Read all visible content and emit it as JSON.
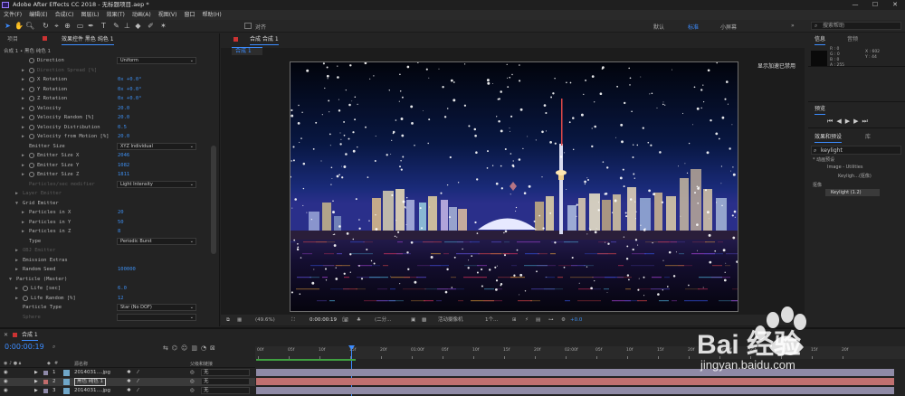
{
  "window": {
    "title": "Adobe After Effects CC 2018 - 无标题项目.aep *",
    "controls": [
      "—",
      "☐",
      "✕"
    ]
  },
  "menu": [
    "文件(F)",
    "编辑(E)",
    "合成(C)",
    "图层(L)",
    "效果(T)",
    "动画(A)",
    "视图(V)",
    "窗口",
    "帮助(H)"
  ],
  "toolbar": {
    "snap_label": "对齐",
    "workspaces": [
      "默认",
      "标准",
      "小屏幕"
    ],
    "active_workspace": "标准",
    "search_placeholder": "搜索帮助",
    "more": "»"
  },
  "left_panel": {
    "tabs": [
      "项目",
      "效果控件 黑色 纯色 1"
    ],
    "breadcrumb": "合成 1 • 黑色 纯色 1",
    "rows": [
      {
        "label": "Direction",
        "dropdown": "Uniform",
        "indent": 2,
        "stopwatch": true
      },
      {
        "label": "Direction Spread [%]",
        "value": "",
        "indent": 2,
        "tri": true,
        "stopwatch": true,
        "dim": true
      },
      {
        "label": "X Rotation",
        "value": "0x +0.0°",
        "indent": 2,
        "tri": true,
        "stopwatch": true
      },
      {
        "label": "Y Rotation",
        "value": "0x +0.0°",
        "indent": 2,
        "tri": true,
        "stopwatch": true
      },
      {
        "label": "Z Rotation",
        "value": "0x +0.0°",
        "indent": 2,
        "tri": true,
        "stopwatch": true
      },
      {
        "label": "Velocity",
        "value": "20.0",
        "indent": 2,
        "tri": true,
        "stopwatch": true
      },
      {
        "label": "Velocity Random [%]",
        "value": "20.0",
        "indent": 2,
        "tri": true,
        "stopwatch": true
      },
      {
        "label": "Velocity Distribution",
        "value": "0.5",
        "indent": 2,
        "tri": true,
        "stopwatch": true
      },
      {
        "label": "Velocity from Motion [%]",
        "value": "20.0",
        "indent": 2,
        "tri": true,
        "stopwatch": true
      },
      {
        "label": "Emitter Size",
        "dropdown": "XYZ Individual",
        "indent": 2,
        "stopwatch": false
      },
      {
        "label": "Emitter Size X",
        "value": "2046",
        "indent": 2,
        "tri": true,
        "stopwatch": true
      },
      {
        "label": "Emitter Size Y",
        "value": "1082",
        "indent": 2,
        "tri": true,
        "stopwatch": true
      },
      {
        "label": "Emitter Size Z",
        "value": "1811",
        "indent": 2,
        "tri": true,
        "stopwatch": true
      },
      {
        "label": "Particles/sec modifier",
        "dropdown": "Light Intensity",
        "indent": 2,
        "dim": true
      },
      {
        "label": "Layer Emitter",
        "indent": 1,
        "tri": true,
        "dim": true
      },
      {
        "label": "Grid Emitter",
        "indent": 1,
        "tri": true,
        "open": true
      },
      {
        "label": "Particles in X",
        "value": "20",
        "indent": 2,
        "tri": true,
        "stopwatch": false
      },
      {
        "label": "Particles in Y",
        "value": "50",
        "indent": 2,
        "tri": true,
        "stopwatch": false
      },
      {
        "label": "Particles in Z",
        "value": "8",
        "indent": 2,
        "tri": true,
        "stopwatch": false
      },
      {
        "label": "Type",
        "dropdown": "Periodic Burst",
        "indent": 2
      },
      {
        "label": "OBJ Emitter",
        "indent": 1,
        "tri": true,
        "dim": true
      },
      {
        "label": "Emission Extras",
        "indent": 1,
        "tri": true
      },
      {
        "label": "Random Seed",
        "value": "100000",
        "indent": 1,
        "tri": true
      },
      {
        "label": "Particle (Master)",
        "indent": 0,
        "tri": true,
        "open": true
      },
      {
        "label": "Life [sec]",
        "value": "6.0",
        "indent": 1,
        "tri": true,
        "stopwatch": true
      },
      {
        "label": "Life Random [%]",
        "value": "12",
        "indent": 1,
        "tri": true,
        "stopwatch": true
      },
      {
        "label": "Particle Type",
        "dropdown": "Star (No DOF)",
        "indent": 1
      },
      {
        "label": "Sphere",
        "dropdown": "",
        "indent": 1,
        "dim": true
      }
    ]
  },
  "viewer": {
    "tab_label": "合成 合成 1",
    "comp_tab": "合成 1",
    "accel_msg": "显示加速已禁用",
    "zoom": "(49.6%)",
    "timecode": "0:00:00:19",
    "resolution": "(二分...",
    "camera": "活动摄像机",
    "views": "1个...",
    "exposure": "+0.0"
  },
  "right_panel": {
    "info_tabs": [
      "信息",
      "音频"
    ],
    "info": {
      "r": "R : 0",
      "g": "G : 0",
      "b": "B : 0",
      "a": "A : 255",
      "x": "X : 602",
      "y": "Y : 44"
    },
    "preview_tab": "预览",
    "effects_tabs": [
      "效果和预设",
      "库"
    ],
    "effects_search": "keylight",
    "tree": [
      "* 动画预设",
      "Image - Utilities",
      "Keyligh...(抠像)",
      "抠像",
      "Keylight (1.2)"
    ]
  },
  "timeline": {
    "tab_label": "合成 1",
    "timecode": "0:00:00:19",
    "col_header": {
      "name": "源名称",
      "parent": "父级和链接"
    },
    "ruler": [
      "00f",
      "05f",
      "10f",
      "15f",
      "20f",
      "01:00f",
      "05f",
      "10f",
      "15f",
      "20f",
      "02:00f",
      "05f",
      "10f",
      "15f",
      "20f",
      "03:00f",
      "05f",
      "10f",
      "15f",
      "20f"
    ],
    "layers": [
      {
        "num": "1",
        "name": "2014031....jpg",
        "parent": "无"
      },
      {
        "num": "2",
        "name": "黑色 纯色 1",
        "parent": "无",
        "selected": true
      },
      {
        "num": "3",
        "name": "2014031....jpg",
        "parent": "无"
      }
    ]
  },
  "watermark": {
    "text": "Bai 经验",
    "url": "jingyan.baidu.com"
  },
  "colors": {
    "accent": "#3c8cff",
    "value_blue": "#3d8ef0",
    "layer_bar_a": "#8f8aa6",
    "layer_bar_b": "#c07070"
  }
}
